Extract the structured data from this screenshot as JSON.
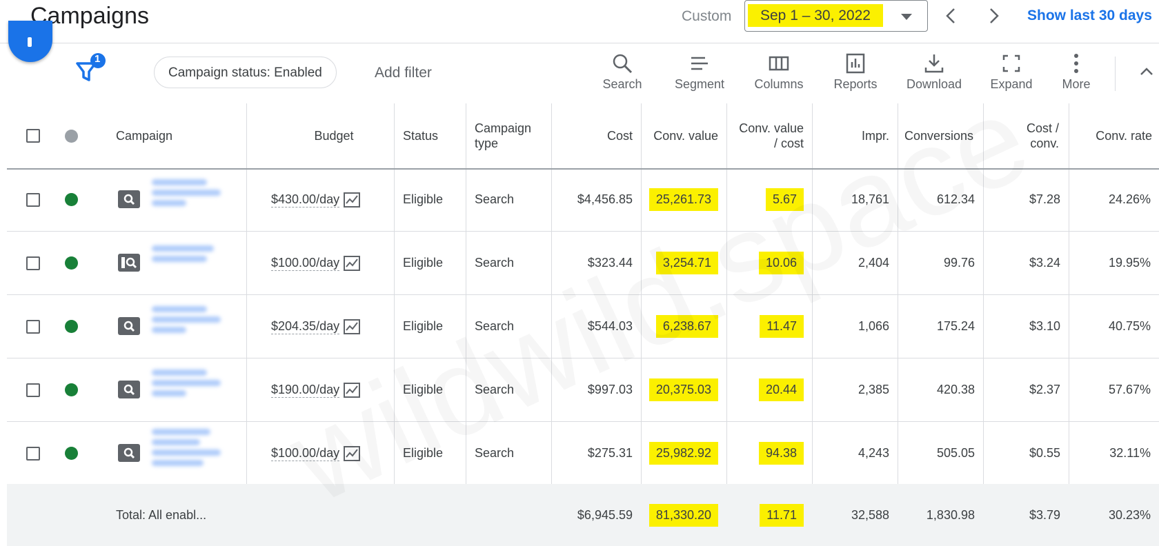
{
  "header": {
    "title": "Campaigns",
    "custom_label": "Custom",
    "date_range": "Sep 1 – 30, 2022",
    "show_last": "Show last 30 days"
  },
  "filter_bar": {
    "filter_count": "1",
    "chip_label": "Campaign status: Enabled",
    "add_filter": "Add filter"
  },
  "toolbar": {
    "search": "Search",
    "segment": "Segment",
    "columns": "Columns",
    "reports": "Reports",
    "download": "Download",
    "expand": "Expand",
    "more": "More"
  },
  "table": {
    "headers": {
      "campaign": "Campaign",
      "budget": "Budget",
      "status": "Status",
      "campaign_type_1": "Campaign",
      "campaign_type_2": "type",
      "cost": "Cost",
      "conv_value": "Conv. value",
      "conv_value_cost_1": "Conv. value",
      "conv_value_cost_2": "/ cost",
      "impr": "Impr.",
      "conversions": "Conversions",
      "cost_conv_1": "Cost /",
      "cost_conv_2": "conv.",
      "conv_rate": "Conv. rate"
    },
    "rows": [
      {
        "budget": "$430.00/day",
        "status": "Eligible",
        "type": "Search",
        "cost": "$4,456.85",
        "conv_value": "25,261.73",
        "conv_value_cost": "5.67",
        "impr": "18,761",
        "conversions": "612.34",
        "cost_conv": "$7.28",
        "conv_rate": "24.26%"
      },
      {
        "budget": "$100.00/day",
        "status": "Eligible",
        "type": "Search",
        "cost": "$323.44",
        "conv_value": "3,254.71",
        "conv_value_cost": "10.06",
        "impr": "2,404",
        "conversions": "99.76",
        "cost_conv": "$3.24",
        "conv_rate": "19.95%"
      },
      {
        "budget": "$204.35/day",
        "status": "Eligible",
        "type": "Search",
        "cost": "$544.03",
        "conv_value": "6,238.67",
        "conv_value_cost": "11.47",
        "impr": "1,066",
        "conversions": "175.24",
        "cost_conv": "$3.10",
        "conv_rate": "40.75%"
      },
      {
        "budget": "$190.00/day",
        "status": "Eligible",
        "type": "Search",
        "cost": "$997.03",
        "conv_value": "20,375.03",
        "conv_value_cost": "20.44",
        "impr": "2,385",
        "conversions": "420.38",
        "cost_conv": "$2.37",
        "conv_rate": "57.67%"
      },
      {
        "budget": "$100.00/day",
        "status": "Eligible",
        "type": "Search",
        "cost": "$275.31",
        "conv_value": "25,982.92",
        "conv_value_cost": "94.38",
        "impr": "4,243",
        "conversions": "505.05",
        "cost_conv": "$0.55",
        "conv_rate": "32.11%"
      }
    ],
    "total": {
      "label": "Total: All enabl...",
      "cost": "$6,945.59",
      "conv_value": "81,330.20",
      "conv_value_cost": "11.71",
      "impr": "32,588",
      "conversions": "1,830.98",
      "cost_conv": "$3.79",
      "conv_rate": "30.23%"
    }
  },
  "watermark": "wildwild.space",
  "colors": {
    "accent_blue": "#1a73e8",
    "highlight_yellow": "#fbf000",
    "status_green": "#188038"
  }
}
